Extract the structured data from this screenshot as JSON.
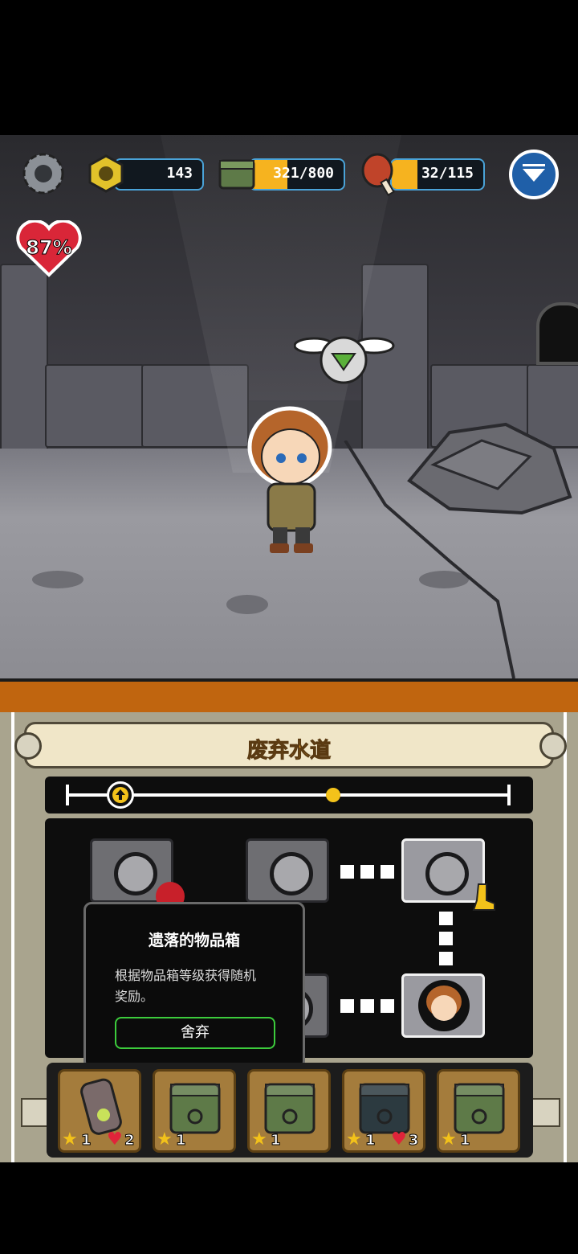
{
  "hud": {
    "bolts": "143",
    "supplies": "321/800",
    "supplies_fill": 0.4,
    "food": "32/115",
    "food_fill": 0.28,
    "health": "87%"
  },
  "map": {
    "title": "废弃水道",
    "progress_marker": 0.12,
    "progress_dot": 0.6
  },
  "popup": {
    "title": "遗落的物品箱",
    "desc_line1": "根据物品箱等级获得随机",
    "desc_line2": "奖励。",
    "button": "舍弃"
  },
  "inventory": [
    {
      "icon": "capsule-icon",
      "stars": "1",
      "hearts": "2"
    },
    {
      "icon": "green-crate-icon",
      "stars": "1",
      "hearts": ""
    },
    {
      "icon": "green-crate-icon",
      "stars": "1",
      "hearts": ""
    },
    {
      "icon": "dark-crate-icon",
      "stars": "1",
      "hearts": "3"
    },
    {
      "icon": "green-crate-icon",
      "stars": "1",
      "hearts": ""
    }
  ],
  "colors": {
    "accent": "#4aa3d8",
    "hud_fill": "#f6b31f",
    "panel": "#a9a48e"
  }
}
